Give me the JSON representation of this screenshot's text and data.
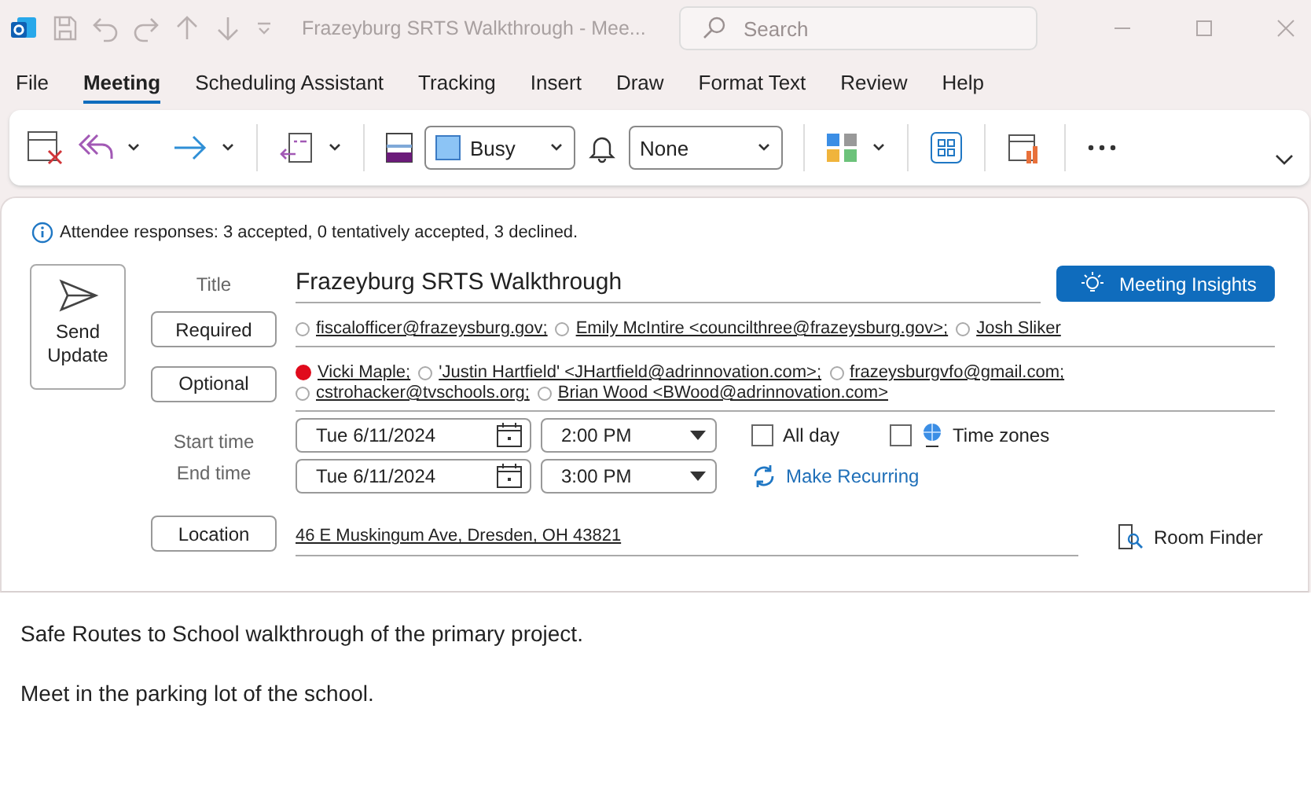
{
  "window": {
    "title": "Frazeyburg SRTS Walkthrough  -  Mee..."
  },
  "search": {
    "placeholder": "Search"
  },
  "tabs": [
    {
      "label": "File",
      "selected": false
    },
    {
      "label": "Meeting",
      "selected": true
    },
    {
      "label": "Scheduling Assistant",
      "selected": false
    },
    {
      "label": "Tracking",
      "selected": false
    },
    {
      "label": "Insert",
      "selected": false
    },
    {
      "label": "Draw",
      "selected": false
    },
    {
      "label": "Format Text",
      "selected": false
    },
    {
      "label": "Review",
      "selected": false
    },
    {
      "label": "Help",
      "selected": false
    }
  ],
  "ribbon": {
    "show_as": "Busy",
    "reminder": "None"
  },
  "info": "Attendee responses: 3 accepted, 0 tentatively accepted, 3 declined.",
  "send_button": "Send Update",
  "title_label": "Title",
  "title_value": "Frazeyburg SRTS Walkthrough",
  "insights_button": "Meeting Insights",
  "required_button": "Required",
  "required": [
    {
      "text": "fiscalofficer@frazeysburg.gov;",
      "declined": false
    },
    {
      "text": "Emily McIntire <councilthree@frazeysburg.gov>;",
      "declined": false
    },
    {
      "text": "Josh  Sliker",
      "declined": false
    }
  ],
  "optional_button": "Optional",
  "optional": [
    {
      "text": "Vicki Maple;",
      "declined": true
    },
    {
      "text": "'Justin Hartfield' <JHartfield@adrinnovation.com>;",
      "declined": false
    },
    {
      "text": "frazeysburgvfo@gmail.com;",
      "declined": false
    },
    {
      "text": "cstrohacker@tvschools.org;",
      "declined": false
    },
    {
      "text": "Brian Wood <BWood@adrinnovation.com>",
      "declined": false
    }
  ],
  "start_label": "Start time",
  "start_date": "Tue 6/11/2024",
  "start_time": "2:00 PM",
  "end_label": "End time",
  "end_date": "Tue 6/11/2024",
  "end_time": "3:00 PM",
  "all_day": {
    "label": "All day",
    "checked": false
  },
  "time_zones": {
    "label": "Time zones",
    "checked": false
  },
  "recurring": "Make Recurring",
  "location_button": "Location",
  "location": "46 E Muskingum Ave, Dresden, OH 43821",
  "room_finder": "Room Finder",
  "body": [
    "Safe Routes to School walkthrough of the primary project.",
    "Meet in the parking lot of the school."
  ]
}
